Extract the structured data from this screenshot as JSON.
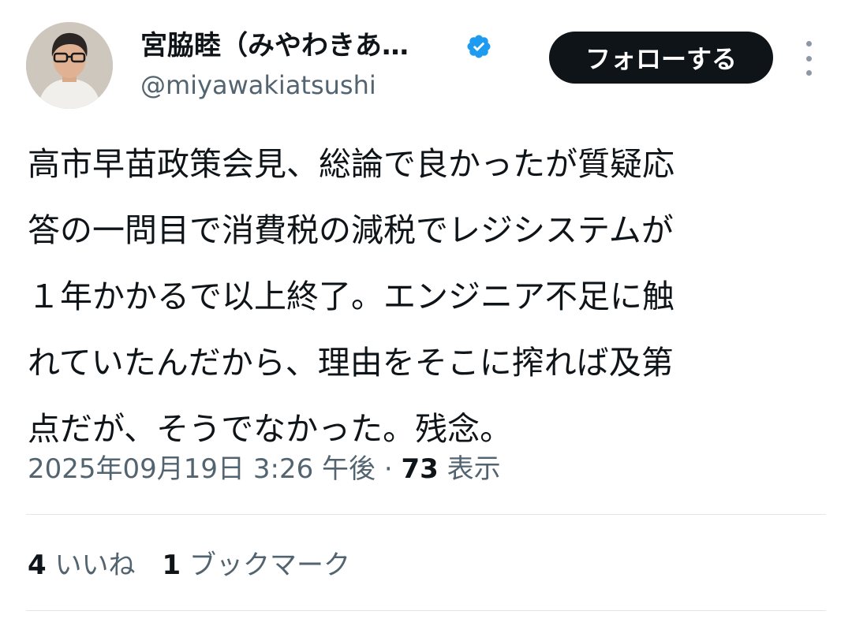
{
  "author": {
    "display_name": "宮脇睦（みやわきあ…",
    "handle": "@miyawakiatsushi"
  },
  "follow_label": "フォローする",
  "tweet": {
    "lines": [
      "高市早苗政策会見、総論で良かったが質疑応",
      "答の一問目で消費税の減税でレジシステムが",
      "１年かかるで以上終了。エンジニア不足に触",
      "れていたんだから、理由をそこに搾れば及第",
      "点だが、そうでなかった。残念。"
    ]
  },
  "meta": {
    "timestamp": "2025年09月19日 3:26 午後",
    "separator": "·",
    "views_count": "73",
    "views_label": "表示"
  },
  "stats": {
    "likes_count": "4",
    "likes_label": "いいね",
    "bookmarks_count": "1",
    "bookmarks_label": "ブックマーク"
  },
  "colors": {
    "verified": "#1d9bf0",
    "primary_text": "#0f1419",
    "secondary_text": "#536471",
    "divider": "#e1e6ea"
  }
}
